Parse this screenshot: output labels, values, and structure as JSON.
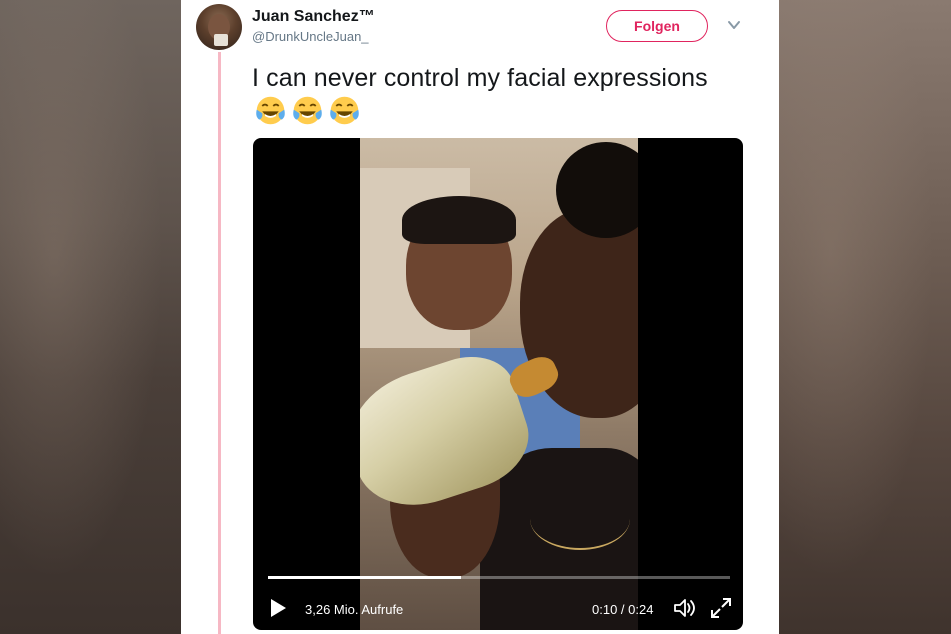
{
  "tweet": {
    "author_name": "Juan Sanchez™",
    "author_handle": "@DrunkUncleJuan_",
    "follow_label": "Folgen",
    "text": "I can never control my facial expressions",
    "emojis": [
      "face-with-tears-of-joy",
      "face-with-tears-of-joy",
      "face-with-tears-of-joy"
    ]
  },
  "video": {
    "views": "3,26 Mio. Aufrufe",
    "time": "0:10 / 0:24",
    "progress": 0.417
  },
  "colors": {
    "accent": "#e0245e",
    "thread_line": "#f6b8c4",
    "text_primary": "#14171a",
    "text_secondary": "#657786"
  },
  "icons": {
    "more": "chevron-down-icon",
    "play": "play-icon",
    "volume": "volume-icon",
    "fullscreen": "fullscreen-icon"
  }
}
